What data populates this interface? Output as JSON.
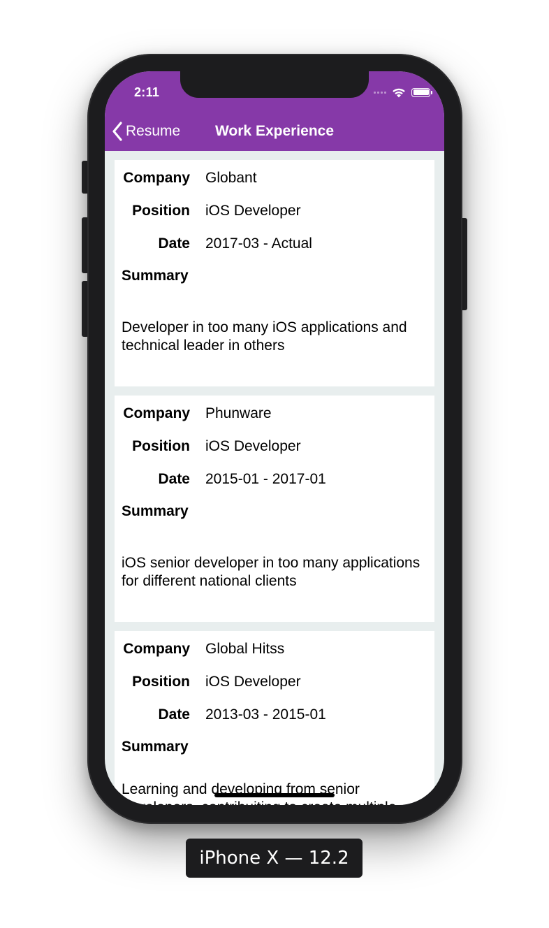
{
  "status_bar": {
    "time": "2:11"
  },
  "nav": {
    "back_label": "Resume",
    "title": "Work Experience"
  },
  "labels": {
    "company": "Company",
    "position": "Position",
    "date": "Date",
    "summary": "Summary"
  },
  "experiences": [
    {
      "company": "Globant",
      "position": "iOS Developer",
      "date": "2017-03 - Actual",
      "summary": "Developer in too many iOS applications and technical leader in others"
    },
    {
      "company": "Phunware",
      "position": "iOS Developer",
      "date": "2015-01 - 2017-01",
      "summary": "iOS senior developer in too many applications for different national clients"
    },
    {
      "company": "Global Hitss",
      "position": "iOS Developer",
      "date": "2013-03 - 2015-01",
      "summary": "Learning and developing from senior developers, contribuiting to create multiple"
    }
  ],
  "device_label": "iPhone X — 12.2",
  "colors": {
    "nav_bar": "#8639a8",
    "background": "#e8eeee",
    "card": "#ffffff"
  },
  "icons": [
    "chevron-left-icon",
    "wifi-icon",
    "battery-icon",
    "signal-icon"
  ]
}
